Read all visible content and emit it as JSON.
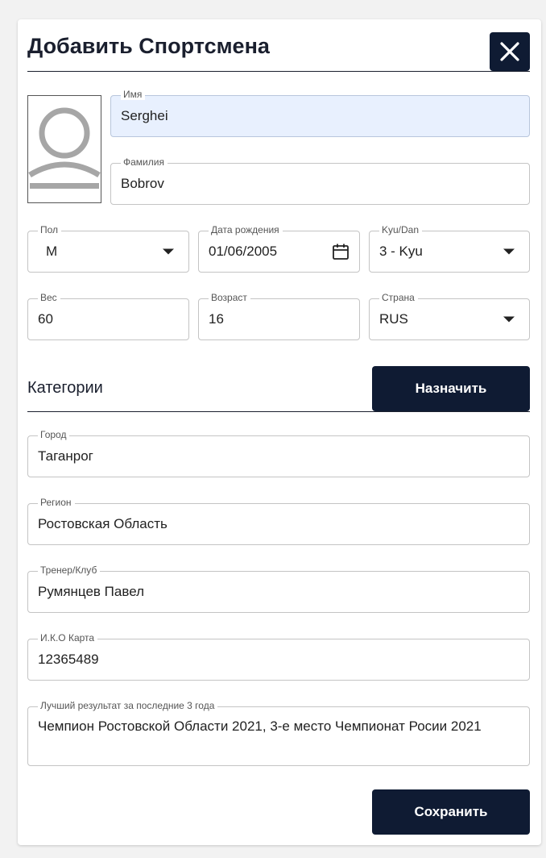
{
  "dialog": {
    "title": "Добавить Спортсмена",
    "close_icon": "close-icon"
  },
  "avatar": {
    "icon": "user-avatar-placeholder-icon"
  },
  "fields": {
    "first_name": {
      "label": "Имя",
      "value": "Serghei"
    },
    "last_name": {
      "label": "Фамилия",
      "value": "Bobrov"
    },
    "gender": {
      "label": "Пол",
      "value": "M"
    },
    "birth_date": {
      "label": "Дата рождения",
      "value": "01/06/2005"
    },
    "kyu_dan": {
      "label": "Kyu/Dan",
      "value": "3 - Kyu"
    },
    "weight": {
      "label": "Вес",
      "value": "60"
    },
    "age": {
      "label": "Возраст",
      "value": "16"
    },
    "country": {
      "label": "Страна",
      "value": "RUS"
    },
    "city": {
      "label": "Город",
      "value": "Таганрог"
    },
    "region": {
      "label": "Регион",
      "value": "Ростовская Область"
    },
    "coach_club": {
      "label": "Тренер/Клуб",
      "value": "Румянцев Павел"
    },
    "iko_card": {
      "label": "И.К.О Карта",
      "value": "12365489"
    },
    "best_result": {
      "label": "Лучший результат за последние 3 года",
      "value": "Чемпион Ростовской Области 2021, 3-е место Чемпионат Росии 2021"
    }
  },
  "categories": {
    "title": "Категории",
    "assign_label": "Назначить"
  },
  "footer": {
    "save_label": "Сохранить"
  },
  "colors": {
    "primary_dark": "#0f1b33",
    "autofill_bg": "#e8f0fe",
    "border": "#c4c4c4"
  }
}
